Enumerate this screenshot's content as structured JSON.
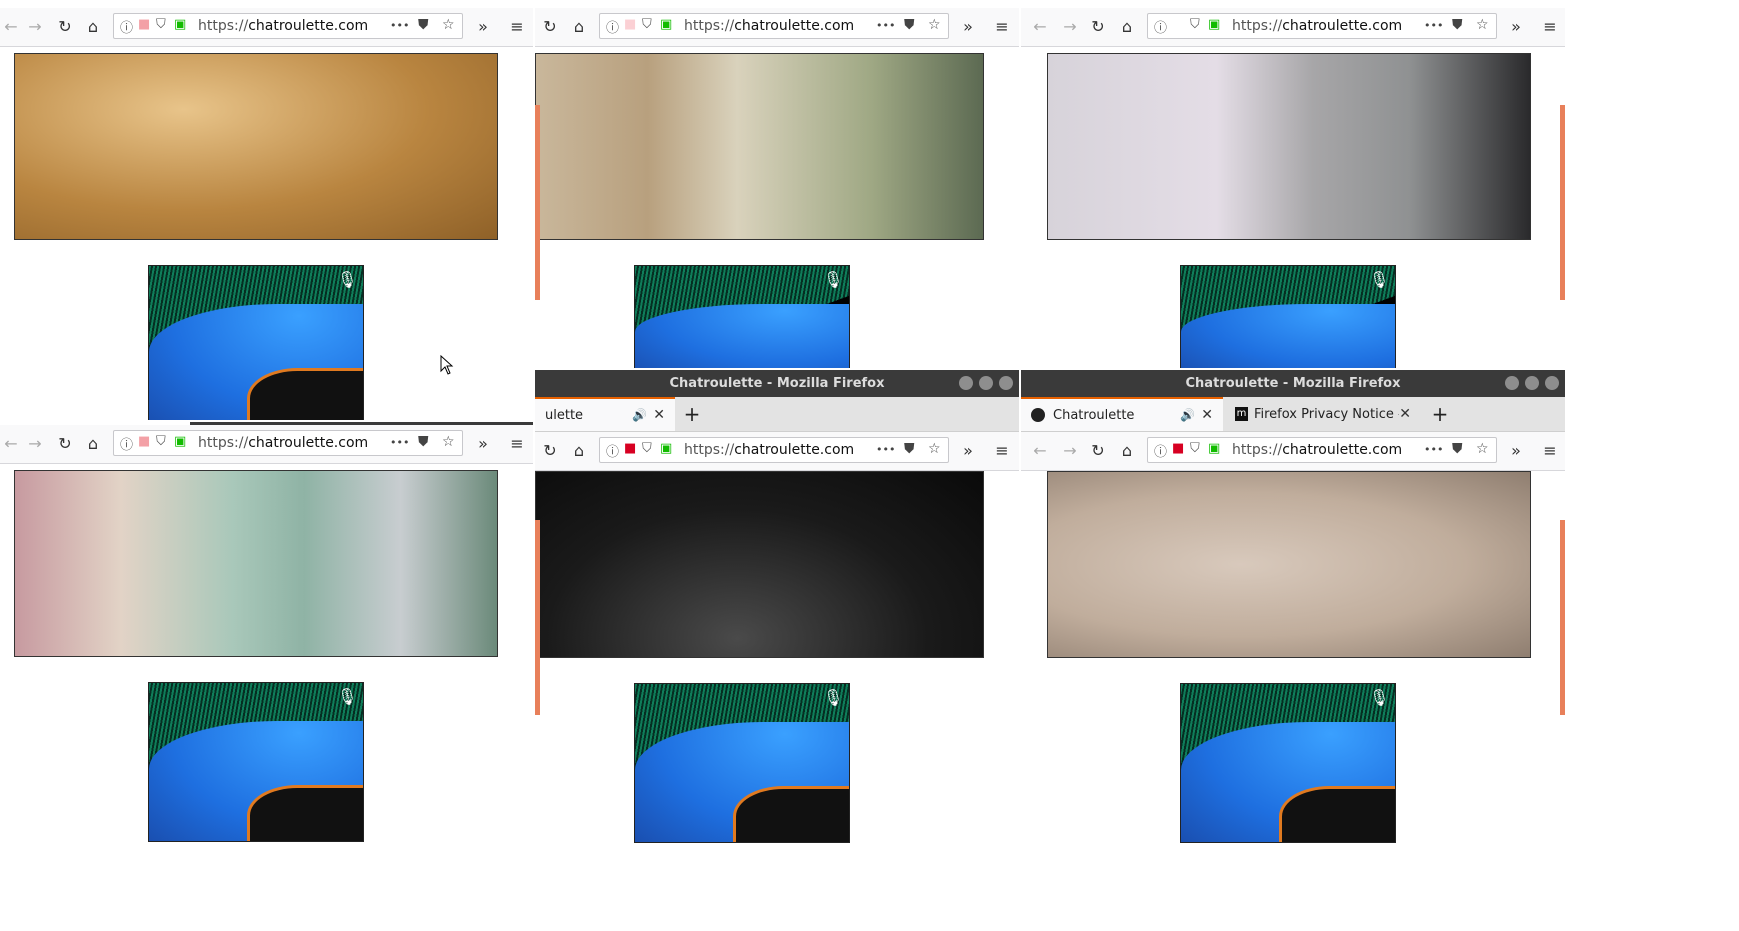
{
  "window_title": "Chatroulette - Mozilla Firefox",
  "url_prefix": "https://",
  "url_domain": "chatroulette.com",
  "tabs": {
    "chatroulette": "Chatroulette",
    "privacy": "Firefox Privacy Notice —",
    "partial": "ulette"
  },
  "icons": {
    "back": "←",
    "forward": "→",
    "reload": "↻",
    "home": "⌂",
    "info": "ⓘ",
    "camera": "■",
    "shield": "⛉",
    "lock": "🔒",
    "more": "•••",
    "pocket": "⛊",
    "star": "☆",
    "overflow": "»",
    "menu": "≡",
    "close": "✕",
    "speaker": "🔊",
    "plus": "+",
    "mic": "🎙"
  },
  "colors": {
    "accent": "#e66000",
    "lock": "#12bc00",
    "camera": "#d70022"
  }
}
